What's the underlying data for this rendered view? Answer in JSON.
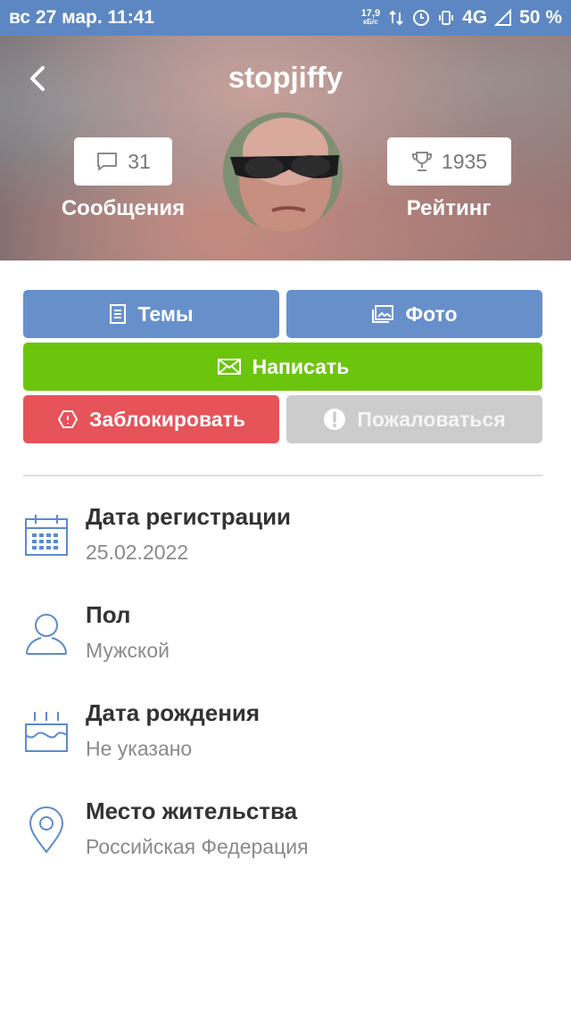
{
  "status_bar": {
    "datetime": "вс 27 мар. 11:41",
    "speed_value": "17,9",
    "speed_unit": "кБ/с",
    "network": "4G",
    "battery": "50 %"
  },
  "header": {
    "username": "stopjiffy",
    "messages_count": "31",
    "messages_label": "Сообщения",
    "rating_value": "1935",
    "rating_label": "Рейтинг"
  },
  "actions": {
    "topics_label": "Темы",
    "photo_label": "Фото",
    "write_label": "Написать",
    "block_label": "Заблокировать",
    "report_label": "Пожаловаться"
  },
  "info": [
    {
      "icon": "calendar-icon",
      "title": "Дата регистрации",
      "value": "25.02.2022"
    },
    {
      "icon": "person-icon",
      "title": "Пол",
      "value": "Мужской"
    },
    {
      "icon": "cake-icon",
      "title": "Дата рождения",
      "value": "Не указано"
    },
    {
      "icon": "location-pin-icon",
      "title": "Место жительства",
      "value": "Российская Федерация"
    }
  ],
  "colors": {
    "status_bar": "#5d87c3",
    "primary_button": "#6790cb",
    "write_button": "#6cc50d",
    "block_button": "#e65358",
    "report_button": "#cccccc",
    "icon_blue": "#5b8ccc"
  }
}
